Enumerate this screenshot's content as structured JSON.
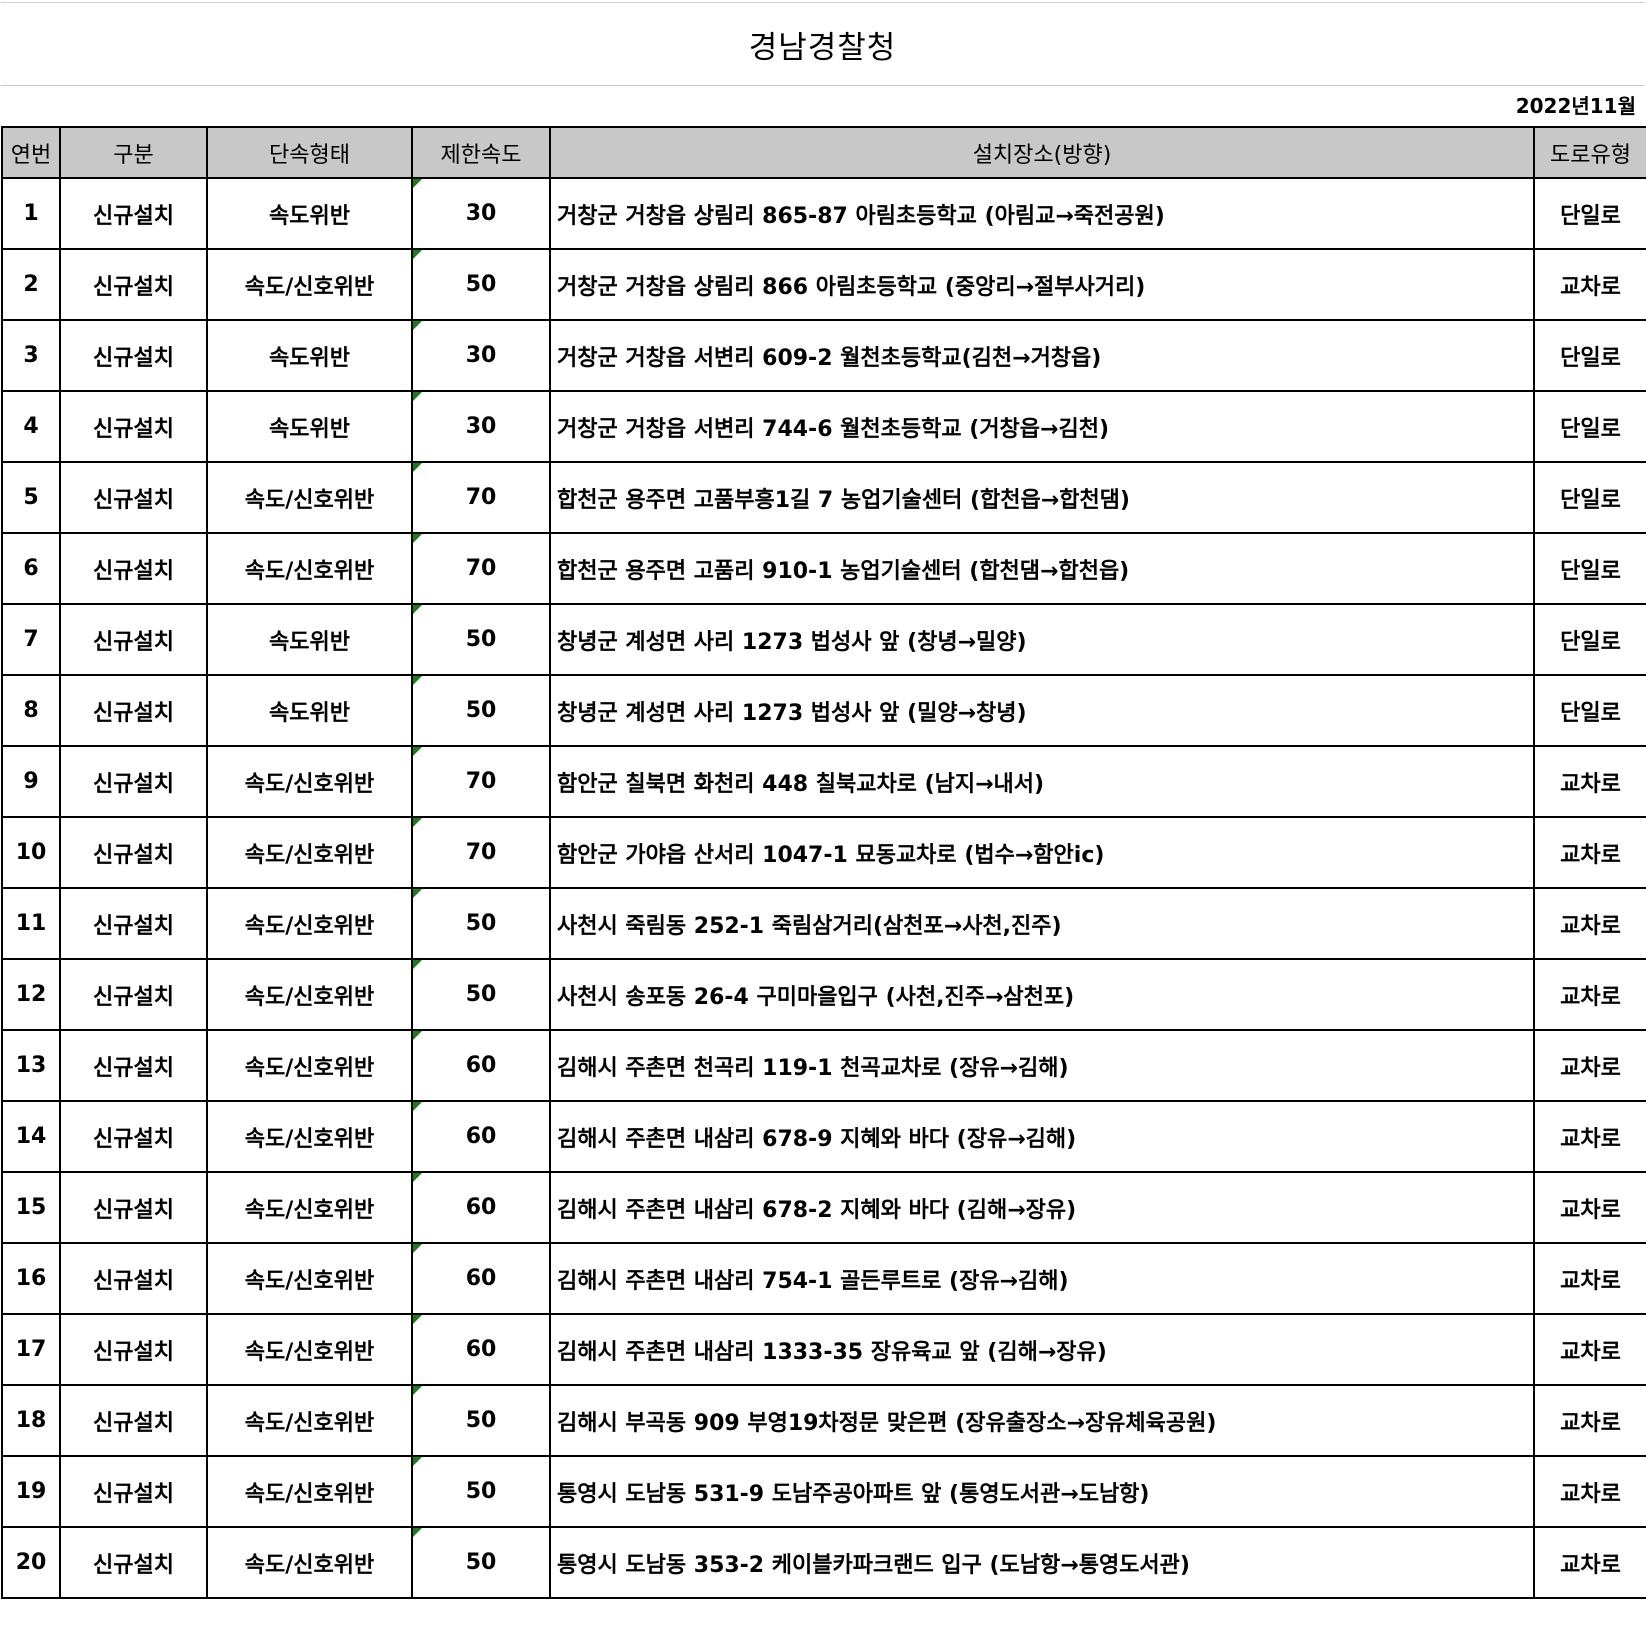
{
  "title": "경남경찰청",
  "date": "2022년11월",
  "headers": [
    "연번",
    "구분",
    "단속형태",
    "제한속도",
    "설치장소(방향)",
    "도로유형"
  ],
  "rows": [
    {
      "no": "1",
      "category": "신규설치",
      "type": "속도위반",
      "limit": "30",
      "location": "거창군 거창읍 상림리 865-87 아림초등학교 (아림교→죽전공원)",
      "road": "단일로"
    },
    {
      "no": "2",
      "category": "신규설치",
      "type": "속도/신호위반",
      "limit": "50",
      "location": "거창군 거창읍 상림리 866 아림초등학교 (중앙리→절부사거리)",
      "road": "교차로"
    },
    {
      "no": "3",
      "category": "신규설치",
      "type": "속도위반",
      "limit": "30",
      "location": "거창군 거창읍 서변리 609-2 월천초등학교(김천→거창읍)",
      "road": "단일로"
    },
    {
      "no": "4",
      "category": "신규설치",
      "type": "속도위반",
      "limit": "30",
      "location": "거창군 거창읍 서변리 744-6 월천초등학교 (거창읍→김천)",
      "road": "단일로"
    },
    {
      "no": "5",
      "category": "신규설치",
      "type": "속도/신호위반",
      "limit": "70",
      "location": "합천군 용주면 고품부흥1길 7 농업기술센터 (합천읍→합천댐)",
      "road": "단일로"
    },
    {
      "no": "6",
      "category": "신규설치",
      "type": "속도/신호위반",
      "limit": "70",
      "location": "합천군 용주면 고품리 910-1 농업기술센터 (합천댐→합천읍)",
      "road": "단일로"
    },
    {
      "no": "7",
      "category": "신규설치",
      "type": "속도위반",
      "limit": "50",
      "location": "창녕군 계성면 사리 1273 법성사 앞 (창녕→밀양)",
      "road": "단일로"
    },
    {
      "no": "8",
      "category": "신규설치",
      "type": "속도위반",
      "limit": "50",
      "location": "창녕군 계성면 사리 1273 법성사 앞 (밀양→창녕)",
      "road": "단일로"
    },
    {
      "no": "9",
      "category": "신규설치",
      "type": "속도/신호위반",
      "limit": "70",
      "location": "함안군 칠북면 화천리 448 칠북교차로 (남지→내서)",
      "road": "교차로"
    },
    {
      "no": "10",
      "category": "신규설치",
      "type": "속도/신호위반",
      "limit": "70",
      "location": "함안군 가야읍 산서리 1047-1 묘동교차로 (법수→함안ic)",
      "road": "교차로"
    },
    {
      "no": "11",
      "category": "신규설치",
      "type": "속도/신호위반",
      "limit": "50",
      "location": "사천시 죽림동 252-1 죽림삼거리(삼천포→사천,진주)",
      "road": "교차로"
    },
    {
      "no": "12",
      "category": "신규설치",
      "type": "속도/신호위반",
      "limit": "50",
      "location": "사천시 송포동 26-4 구미마을입구 (사천,진주→삼천포)",
      "road": "교차로"
    },
    {
      "no": "13",
      "category": "신규설치",
      "type": "속도/신호위반",
      "limit": "60",
      "location": "김해시 주촌면 천곡리 119-1 천곡교차로 (장유→김해)",
      "road": "교차로"
    },
    {
      "no": "14",
      "category": "신규설치",
      "type": "속도/신호위반",
      "limit": "60",
      "location": "김해시 주촌면 내삼리 678-9 지혜와 바다 (장유→김해)",
      "road": "교차로"
    },
    {
      "no": "15",
      "category": "신규설치",
      "type": "속도/신호위반",
      "limit": "60",
      "location": "김해시 주촌면 내삼리 678-2 지혜와 바다 (김해→장유)",
      "road": "교차로"
    },
    {
      "no": "16",
      "category": "신규설치",
      "type": "속도/신호위반",
      "limit": "60",
      "location": "김해시 주촌면 내삼리 754-1 골든루트로 (장유→김해)",
      "road": "교차로"
    },
    {
      "no": "17",
      "category": "신규설치",
      "type": "속도/신호위반",
      "limit": "60",
      "location": "김해시 주촌면 내삼리 1333-35 장유육교 앞 (김해→장유)",
      "road": "교차로"
    },
    {
      "no": "18",
      "category": "신규설치",
      "type": "속도/신호위반",
      "limit": "50",
      "location": "김해시 부곡동 909 부영19차정문 맞은편 (장유출장소→장유체육공원)",
      "road": "교차로"
    },
    {
      "no": "19",
      "category": "신규설치",
      "type": "속도/신호위반",
      "limit": "50",
      "location": "통영시 도남동 531-9 도남주공아파트 앞 (통영도서관→도남항)",
      "road": "교차로"
    },
    {
      "no": "20",
      "category": "신규설치",
      "type": "속도/신호위반",
      "limit": "50",
      "location": "통영시 도남동 353-2 케이블카파크랜드 입구 (도남항→통영도서관)",
      "road": "교차로"
    }
  ]
}
